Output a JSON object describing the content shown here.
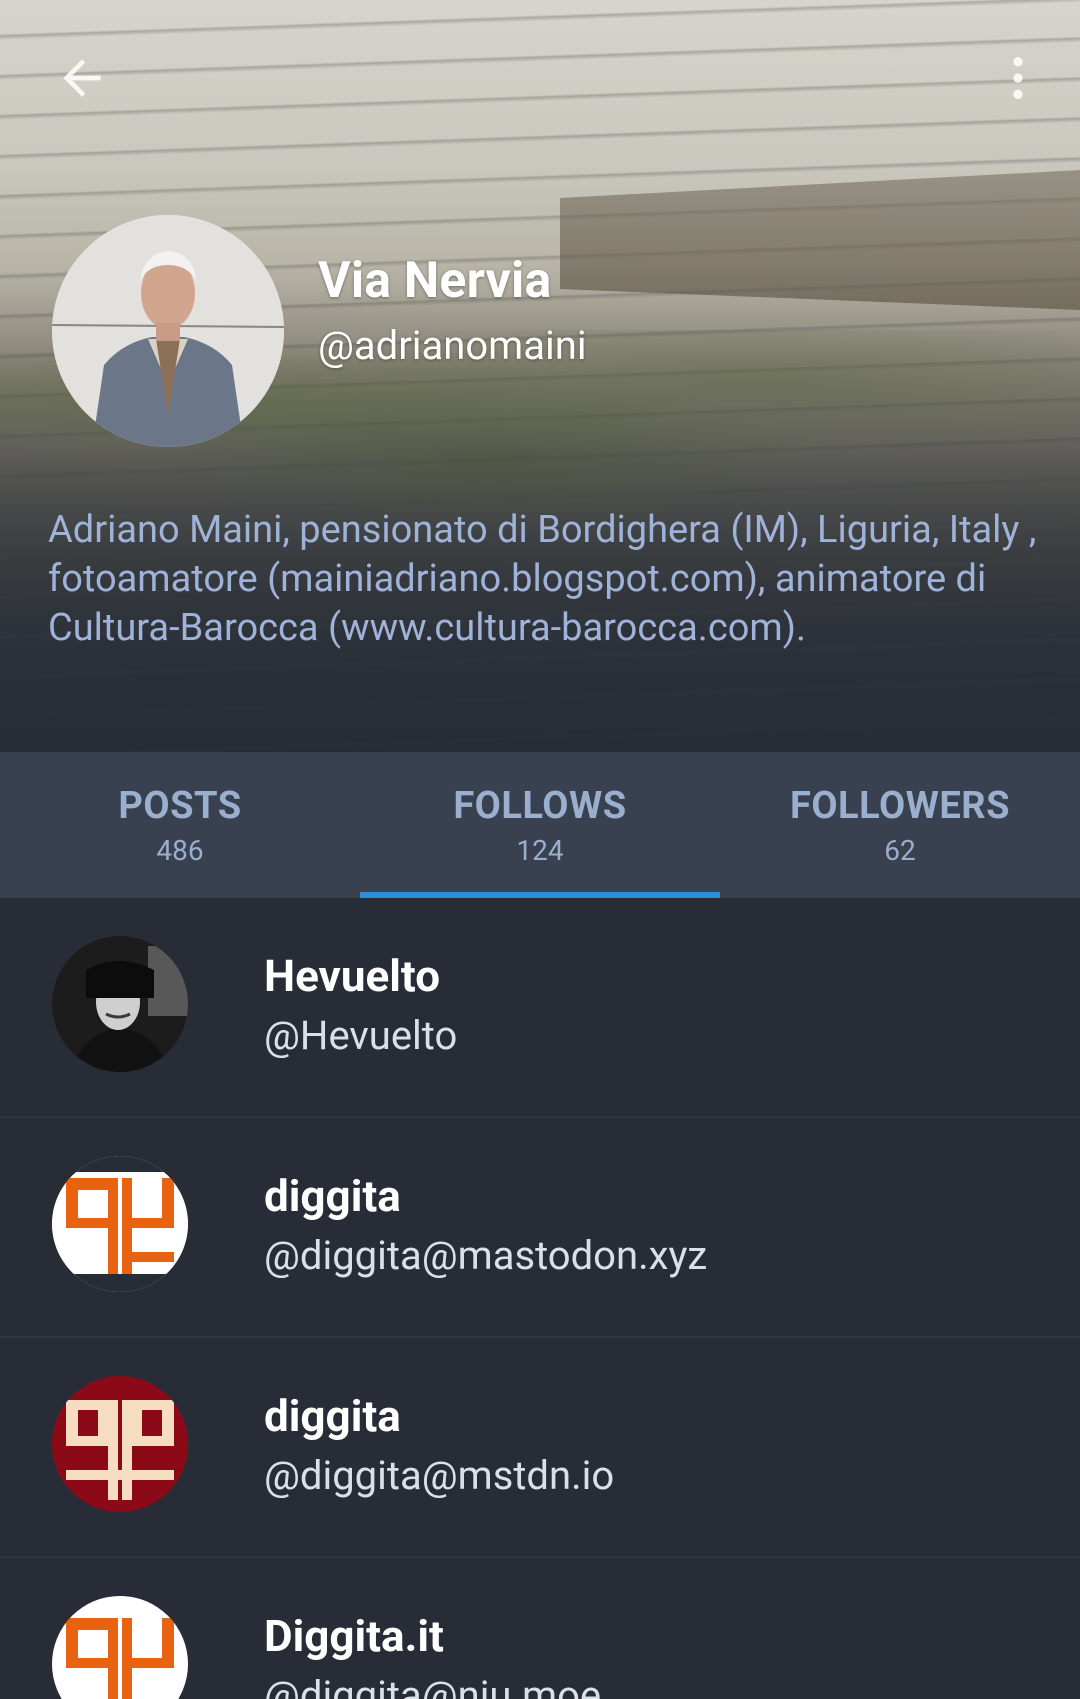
{
  "header": {
    "back_icon": "arrow-back-icon",
    "more_icon": "more-vertical-icon",
    "display_name": "Via Nervia",
    "username": "@adrianomaini",
    "bio": "Adriano Maini, pensionato di Bordighera (IM), Liguria, Italy , fotoamatore (mainiadriano.blogspot.com), animatore di Cultura-Barocca (www.cultura-barocca.com)."
  },
  "tabs": [
    {
      "label": "POSTS",
      "count": "486"
    },
    {
      "label": "FOLLOWS",
      "count": "124"
    },
    {
      "label": "FOLLOWERS",
      "count": "62"
    }
  ],
  "active_tab": "FOLLOWS",
  "colors": {
    "background": "#282c37",
    "tab_bar": "#39404f",
    "accent": "#2b90d9",
    "tab_text": "#9aaecd",
    "bio_text": "#9fb2d8"
  },
  "follows": [
    {
      "name": "Hevuelto",
      "handle": "@Hevuelto"
    },
    {
      "name": "diggita",
      "handle": "@diggita@mastodon.xyz"
    },
    {
      "name": "diggita",
      "handle": "@diggita@mstdn.io"
    },
    {
      "name": "Diggita.it",
      "handle": "@diggita@niu.moe"
    }
  ]
}
